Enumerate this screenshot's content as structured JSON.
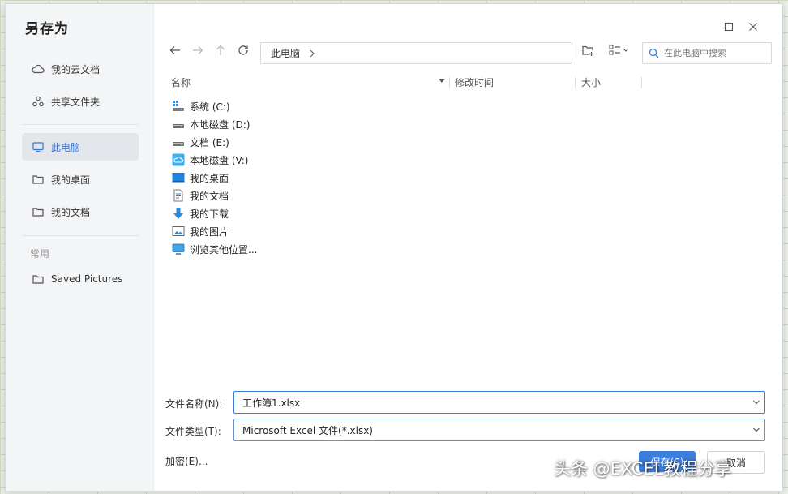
{
  "dialog": {
    "title": "另存为"
  },
  "sidebar": {
    "items": [
      {
        "label": "我的云文档",
        "icon": "cloud-icon"
      },
      {
        "label": "共享文件夹",
        "icon": "share-icon"
      },
      {
        "label": "此电脑",
        "icon": "monitor-icon",
        "active": true
      },
      {
        "label": "我的桌面",
        "icon": "folder-icon"
      },
      {
        "label": "我的文档",
        "icon": "folder-icon"
      }
    ],
    "group_label": "常用",
    "group_items": [
      {
        "label": "Saved Pictures",
        "icon": "folder-icon"
      }
    ]
  },
  "toolbar": {
    "breadcrumb": "此电脑",
    "search_placeholder": "在此电脑中搜索"
  },
  "columns": {
    "name": "名称",
    "modified": "修改时间",
    "size": "大小"
  },
  "files": [
    {
      "label": "系统 (C:)",
      "icon": "system-drive-icon"
    },
    {
      "label": "本地磁盘 (D:)",
      "icon": "drive-icon"
    },
    {
      "label": "文档 (E:)",
      "icon": "drive-icon"
    },
    {
      "label": "本地磁盘 (V:)",
      "icon": "cloud-drive-icon"
    },
    {
      "label": "我的桌面",
      "icon": "desktop-icon"
    },
    {
      "label": "我的文档",
      "icon": "document-icon"
    },
    {
      "label": "我的下载",
      "icon": "download-icon"
    },
    {
      "label": "我的图片",
      "icon": "picture-icon"
    },
    {
      "label": "浏览其他位置...",
      "icon": "browse-icon"
    }
  ],
  "form": {
    "filename_label": "文件名称(N):",
    "filename_value": "工作簿1.xlsx",
    "filetype_label": "文件类型(T):",
    "filetype_value": "Microsoft Excel 文件(*.xlsx)",
    "encrypt_label": "加密(E)...",
    "save_label": "保存(S)",
    "cancel_label": "取消"
  },
  "watermark": "头条 @EXCEL教程分享",
  "colors": {
    "accent": "#3b7ddd",
    "sidebar_bg": "#f4f5f7",
    "active_text": "#3874d8"
  }
}
